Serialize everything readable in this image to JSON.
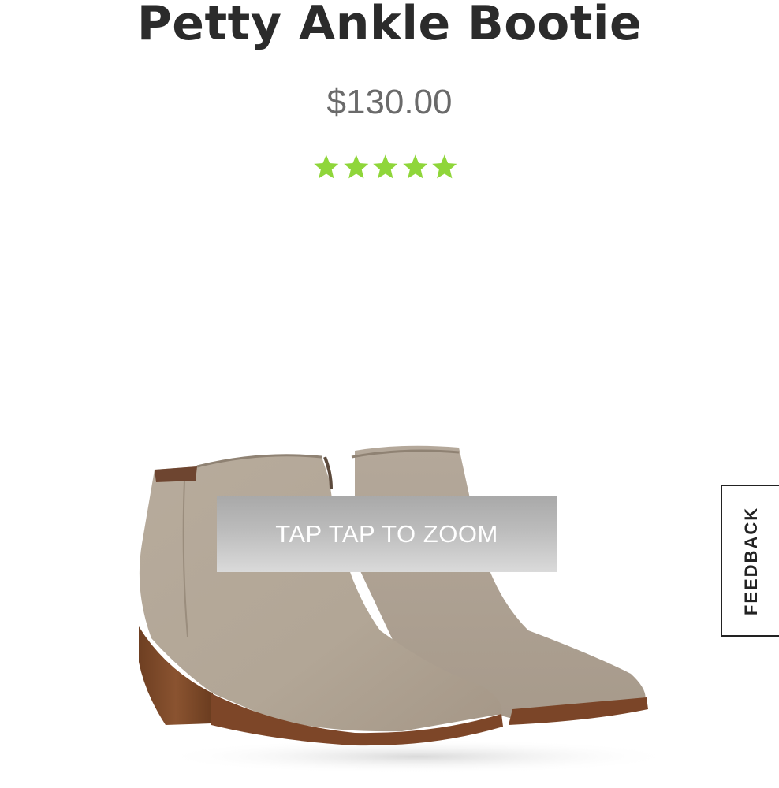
{
  "product": {
    "title": "Petty Ankle Bootie",
    "price": "$130.00",
    "rating": 5,
    "rating_max": 5,
    "star_color": "#8fd63a"
  },
  "image": {
    "icon": "ankle-boots-product-photo",
    "zoom_hint": "TAP TAP TO ZOOM"
  },
  "feedback": {
    "label": "FEEDBACK"
  }
}
